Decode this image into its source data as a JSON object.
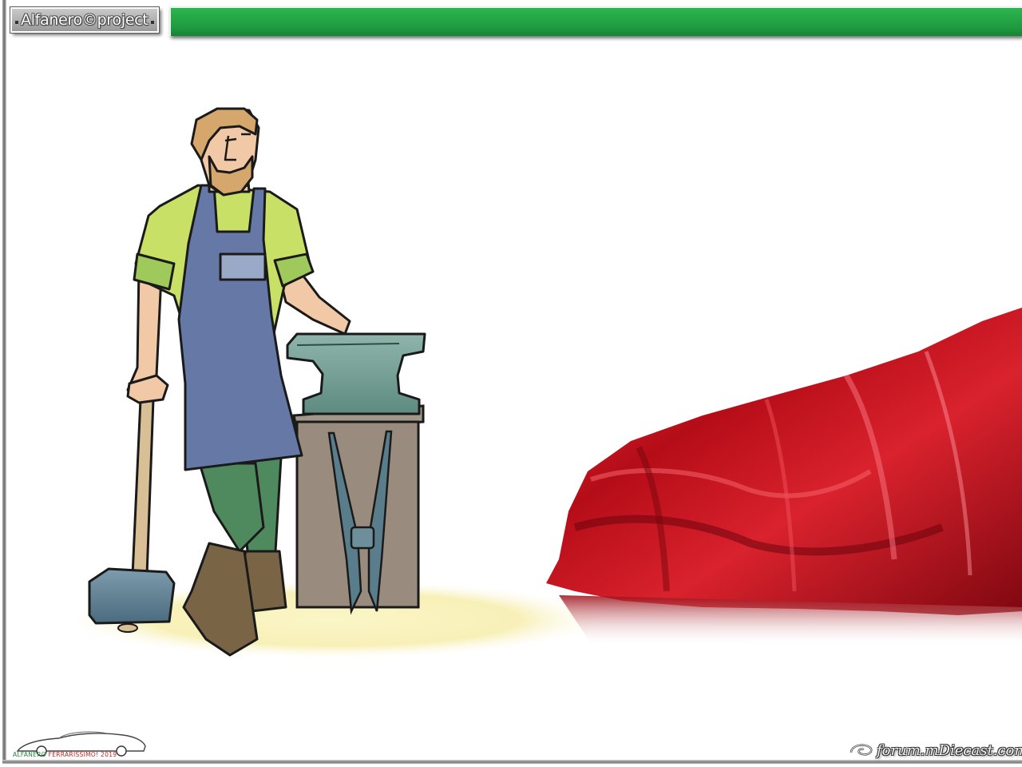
{
  "header": {
    "brand_label": "Alfanero©project",
    "bar_color": "#1f9a3f"
  },
  "scene": {
    "illustration": "blacksmith-with-anvil-and-hammer",
    "covered_object": "car-under-red-silk-cover",
    "cover_color": "#c8141e"
  },
  "footer": {
    "left_logo_text_1": "ALFANERO",
    "left_logo_text_2": "FERRARISSIMO! 2019",
    "right_watermark": "forum.mDiecast.com"
  }
}
